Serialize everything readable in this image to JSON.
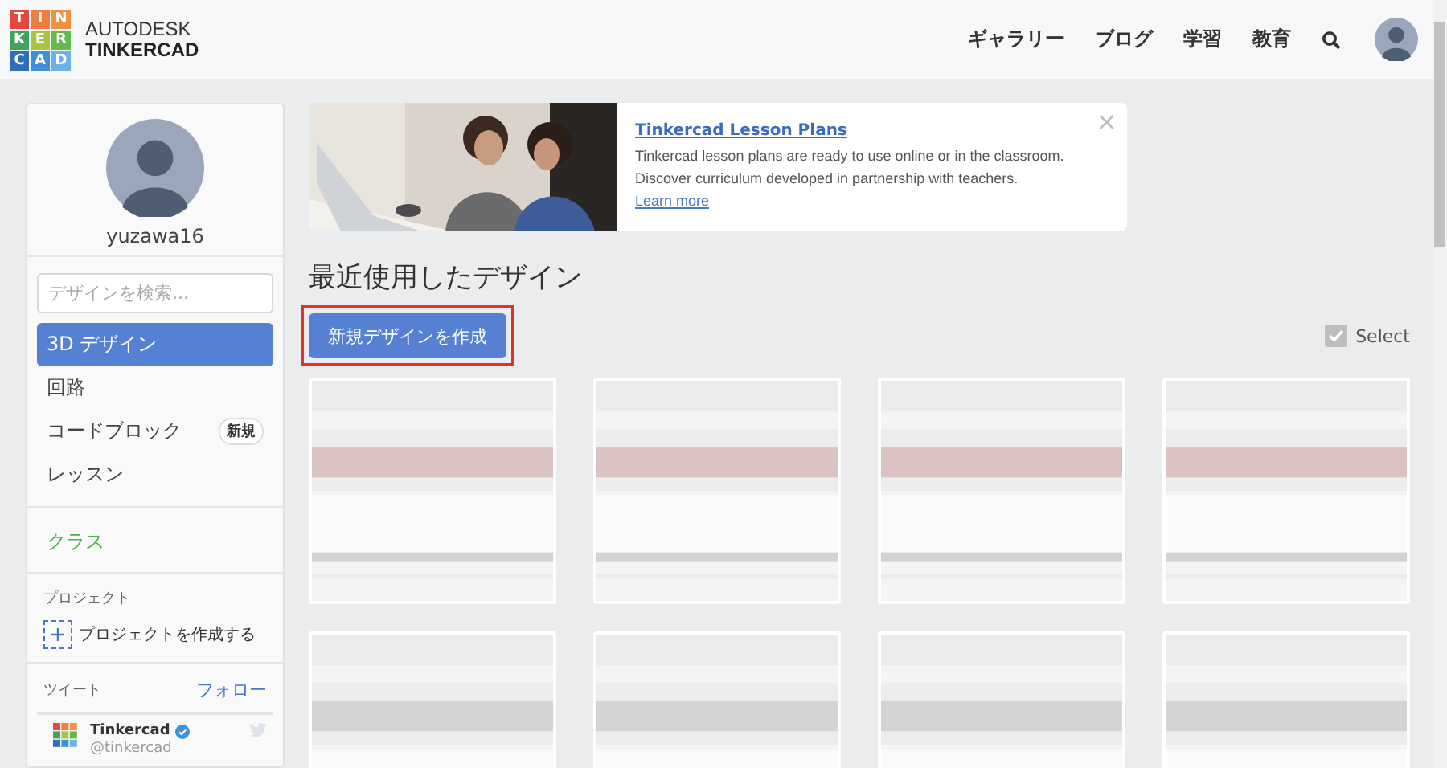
{
  "header": {
    "logo_tiles": [
      {
        "letter": "T",
        "color": "#e5473d"
      },
      {
        "letter": "I",
        "color": "#ef7d3c"
      },
      {
        "letter": "N",
        "color": "#f0913f"
      },
      {
        "letter": "K",
        "color": "#3ea55b"
      },
      {
        "letter": "E",
        "color": "#a9c23f"
      },
      {
        "letter": "R",
        "color": "#62b94c"
      },
      {
        "letter": "C",
        "color": "#2f6fba"
      },
      {
        "letter": "A",
        "color": "#3d8fd6"
      },
      {
        "letter": "D",
        "color": "#6fb0e6"
      }
    ],
    "brand_top": "AUTODESK",
    "brand_bottom": "TINKERCAD",
    "nav": [
      "ギャラリー",
      "ブログ",
      "学習",
      "教育"
    ]
  },
  "sidebar": {
    "username": "yuzawa16",
    "search": {
      "placeholder": "デザインを検索..."
    },
    "items": [
      {
        "label": "3D デザイン",
        "selected": true
      },
      {
        "label": "回路",
        "selected": false
      },
      {
        "label": "コードブロック",
        "selected": false,
        "badge": "新規"
      },
      {
        "label": "レッスン",
        "selected": false
      }
    ],
    "class_link": "クラス",
    "projects_heading": "プロジェクト",
    "create_project": "プロジェクトを作成する",
    "tweets_heading": "ツイート",
    "follow": "フォロー",
    "tweet": {
      "name": "Tinkercad",
      "handle": "@tinkercad",
      "verified": true
    }
  },
  "banner": {
    "title": "Tinkercad Lesson Plans",
    "text": "Tinkercad lesson plans are ready to use online or in the classroom. Discover curriculum developed in partnership with teachers.",
    "link": "Learn more",
    "close": "×"
  },
  "heading": "最近使用したデザイン",
  "create_button": {
    "label": "新規デザインを作成",
    "highlighted": true
  },
  "select": {
    "label": "Select"
  }
}
